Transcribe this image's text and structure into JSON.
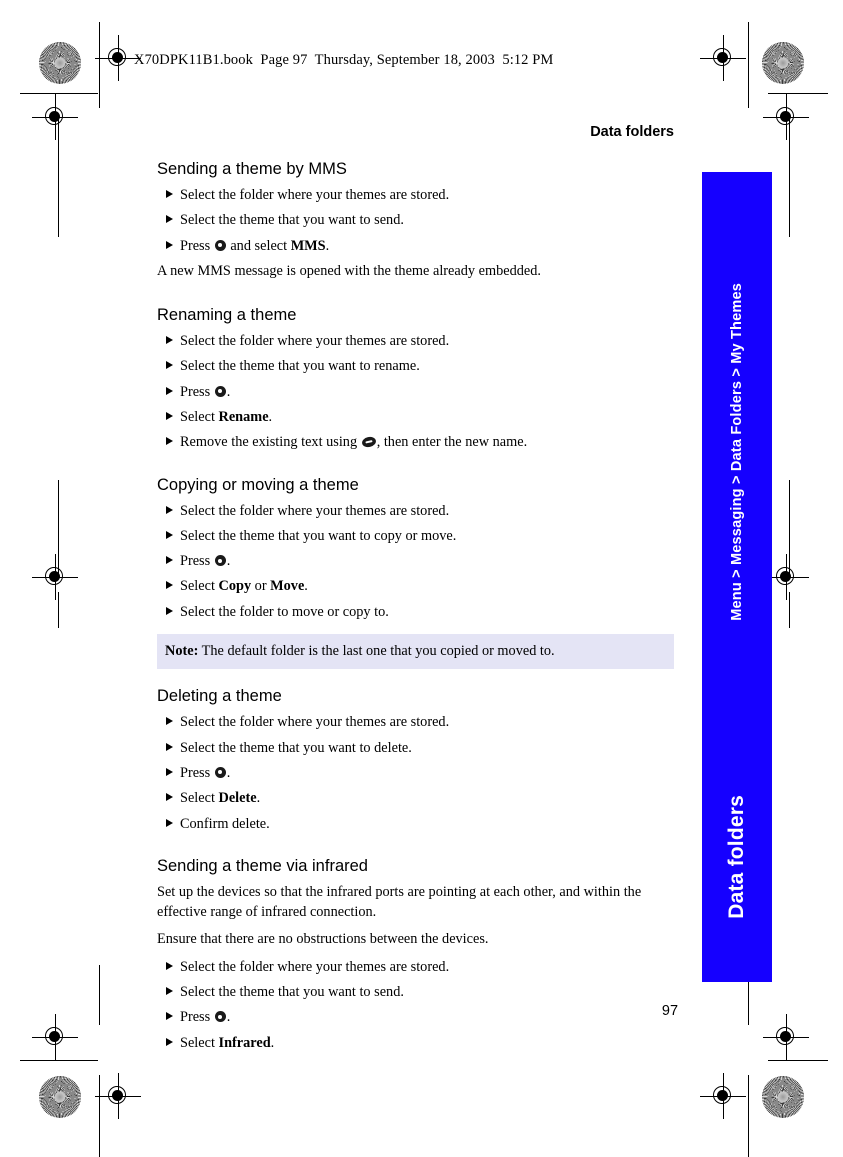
{
  "page": {
    "file_header": "X70DPK11B1.book  Page 97  Thursday, September 18, 2003  5:12 PM",
    "chapter_title": "Data folders",
    "folio": "97"
  },
  "side_tab": {
    "breadcrumb": "Menu > Messaging > Data Folders > My Themes",
    "chapter": "Data folders",
    "color": "#1500FF",
    "text_color": "#FFFFFF"
  },
  "note": {
    "label": "Note:",
    "text": " The default folder is the last one that you copied or moved to.",
    "background": "#E4E4F5"
  },
  "sections": [
    {
      "heading": "Sending a theme by MMS",
      "steps": [
        {
          "parts": [
            {
              "t": "text",
              "v": "Select the folder where your themes are stored."
            }
          ]
        },
        {
          "parts": [
            {
              "t": "text",
              "v": "Select the theme that you want to send."
            }
          ]
        },
        {
          "parts": [
            {
              "t": "text",
              "v": "Press "
            },
            {
              "t": "icon",
              "v": "select-key-icon"
            },
            {
              "t": "text",
              "v": " and select "
            },
            {
              "t": "bold",
              "v": "MMS"
            },
            {
              "t": "text",
              "v": "."
            }
          ]
        }
      ],
      "after_paragraphs": [
        "A new MMS message is opened with the theme already embedded."
      ]
    },
    {
      "heading": "Renaming a theme",
      "steps": [
        {
          "parts": [
            {
              "t": "text",
              "v": "Select the folder where your themes are stored."
            }
          ]
        },
        {
          "parts": [
            {
              "t": "text",
              "v": "Select the theme that you want to rename."
            }
          ]
        },
        {
          "parts": [
            {
              "t": "text",
              "v": "Press "
            },
            {
              "t": "icon",
              "v": "select-key-icon"
            },
            {
              "t": "text",
              "v": "."
            }
          ]
        },
        {
          "parts": [
            {
              "t": "text",
              "v": "Select "
            },
            {
              "t": "bold",
              "v": "Rename"
            },
            {
              "t": "text",
              "v": "."
            }
          ]
        },
        {
          "parts": [
            {
              "t": "text",
              "v": "Remove the existing text using "
            },
            {
              "t": "icon",
              "v": "clear-key-icon"
            },
            {
              "t": "text",
              "v": ", then enter the new name."
            }
          ]
        }
      ],
      "after_paragraphs": []
    },
    {
      "heading": "Copying or moving a theme",
      "steps": [
        {
          "parts": [
            {
              "t": "text",
              "v": "Select the folder where your themes are stored."
            }
          ]
        },
        {
          "parts": [
            {
              "t": "text",
              "v": "Select the theme that you want to copy or move."
            }
          ]
        },
        {
          "parts": [
            {
              "t": "text",
              "v": "Press "
            },
            {
              "t": "icon",
              "v": "select-key-icon"
            },
            {
              "t": "text",
              "v": "."
            }
          ]
        },
        {
          "parts": [
            {
              "t": "text",
              "v": "Select "
            },
            {
              "t": "bold",
              "v": "Copy"
            },
            {
              "t": "text",
              "v": " or "
            },
            {
              "t": "bold",
              "v": "Move"
            },
            {
              "t": "text",
              "v": "."
            }
          ]
        },
        {
          "parts": [
            {
              "t": "text",
              "v": "Select the folder to move or copy to."
            }
          ]
        }
      ],
      "after_paragraphs": [],
      "note_after": true
    },
    {
      "heading": "Deleting a theme",
      "steps": [
        {
          "parts": [
            {
              "t": "text",
              "v": "Select the folder where your themes are stored."
            }
          ]
        },
        {
          "parts": [
            {
              "t": "text",
              "v": "Select the theme that you want to delete."
            }
          ]
        },
        {
          "parts": [
            {
              "t": "text",
              "v": "Press "
            },
            {
              "t": "icon",
              "v": "select-key-icon"
            },
            {
              "t": "text",
              "v": "."
            }
          ]
        },
        {
          "parts": [
            {
              "t": "text",
              "v": "Select "
            },
            {
              "t": "bold",
              "v": "Delete"
            },
            {
              "t": "text",
              "v": "."
            }
          ]
        },
        {
          "parts": [
            {
              "t": "text",
              "v": "Confirm delete."
            }
          ]
        }
      ],
      "after_paragraphs": []
    },
    {
      "heading": "Sending a theme via infrared",
      "before_paragraphs": [
        "Set up the devices so that the infrared ports are pointing at each other, and within the effective range of infrared connection.",
        "Ensure that there are no obstructions between the devices."
      ],
      "steps": [
        {
          "parts": [
            {
              "t": "text",
              "v": "Select the folder where your themes are stored."
            }
          ]
        },
        {
          "parts": [
            {
              "t": "text",
              "v": "Select the theme that you want to send."
            }
          ]
        },
        {
          "parts": [
            {
              "t": "text",
              "v": "Press "
            },
            {
              "t": "icon",
              "v": "select-key-icon"
            },
            {
              "t": "text",
              "v": "."
            }
          ]
        },
        {
          "parts": [
            {
              "t": "text",
              "v": "Select "
            },
            {
              "t": "bold",
              "v": "Infrared"
            },
            {
              "t": "text",
              "v": "."
            }
          ]
        }
      ],
      "after_paragraphs": []
    }
  ]
}
